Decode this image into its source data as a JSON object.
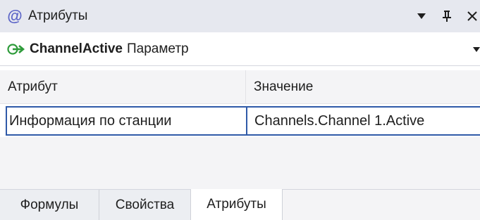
{
  "window": {
    "title": "Атрибуты",
    "app_icon_glyph": "@",
    "app_icon": "at-sign-icon",
    "controls": {
      "menu_icon": "dropdown-triangle-icon",
      "pin_icon": "pin-icon",
      "close_icon": "close-icon"
    }
  },
  "selector": {
    "object_name": "ChannelActive",
    "object_type": "Параметр",
    "icon": "green-arrow-icon"
  },
  "grid": {
    "columns": [
      "Атрибут",
      "Значение"
    ],
    "rows": [
      {
        "attribute": "Информация по станции",
        "value": "Channels.Channel 1.Active"
      }
    ]
  },
  "tabs": [
    {
      "label": "Формулы",
      "active": false
    },
    {
      "label": "Свойства",
      "active": false
    },
    {
      "label": "Атрибуты",
      "active": true
    }
  ],
  "colors": {
    "titlebar_bg": "#e6e8ef",
    "accent_icon": "#5b64c7",
    "selection_border": "#2f5aa8",
    "go_arrow": "#2e9b3a"
  }
}
